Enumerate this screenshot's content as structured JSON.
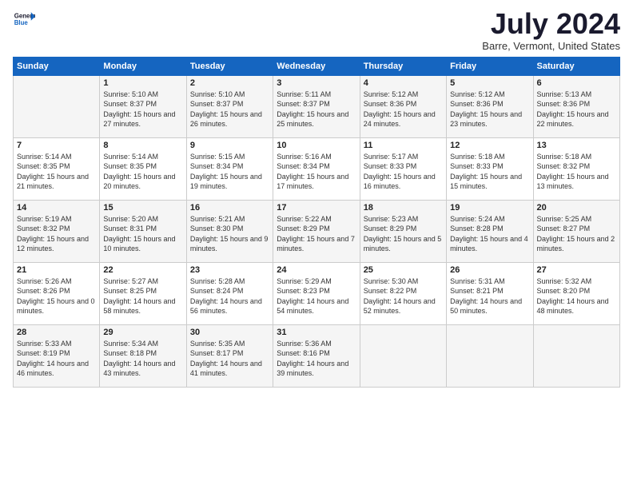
{
  "logo": {
    "line1": "General",
    "line2": "Blue"
  },
  "title": "July 2024",
  "location": "Barre, Vermont, United States",
  "days_header": [
    "Sunday",
    "Monday",
    "Tuesday",
    "Wednesday",
    "Thursday",
    "Friday",
    "Saturday"
  ],
  "weeks": [
    [
      {
        "day": "",
        "info": ""
      },
      {
        "day": "1",
        "info": "Sunrise: 5:10 AM\nSunset: 8:37 PM\nDaylight: 15 hours\nand 27 minutes."
      },
      {
        "day": "2",
        "info": "Sunrise: 5:10 AM\nSunset: 8:37 PM\nDaylight: 15 hours\nand 26 minutes."
      },
      {
        "day": "3",
        "info": "Sunrise: 5:11 AM\nSunset: 8:37 PM\nDaylight: 15 hours\nand 25 minutes."
      },
      {
        "day": "4",
        "info": "Sunrise: 5:12 AM\nSunset: 8:36 PM\nDaylight: 15 hours\nand 24 minutes."
      },
      {
        "day": "5",
        "info": "Sunrise: 5:12 AM\nSunset: 8:36 PM\nDaylight: 15 hours\nand 23 minutes."
      },
      {
        "day": "6",
        "info": "Sunrise: 5:13 AM\nSunset: 8:36 PM\nDaylight: 15 hours\nand 22 minutes."
      }
    ],
    [
      {
        "day": "7",
        "info": "Sunrise: 5:14 AM\nSunset: 8:35 PM\nDaylight: 15 hours\nand 21 minutes."
      },
      {
        "day": "8",
        "info": "Sunrise: 5:14 AM\nSunset: 8:35 PM\nDaylight: 15 hours\nand 20 minutes."
      },
      {
        "day": "9",
        "info": "Sunrise: 5:15 AM\nSunset: 8:34 PM\nDaylight: 15 hours\nand 19 minutes."
      },
      {
        "day": "10",
        "info": "Sunrise: 5:16 AM\nSunset: 8:34 PM\nDaylight: 15 hours\nand 17 minutes."
      },
      {
        "day": "11",
        "info": "Sunrise: 5:17 AM\nSunset: 8:33 PM\nDaylight: 15 hours\nand 16 minutes."
      },
      {
        "day": "12",
        "info": "Sunrise: 5:18 AM\nSunset: 8:33 PM\nDaylight: 15 hours\nand 15 minutes."
      },
      {
        "day": "13",
        "info": "Sunrise: 5:18 AM\nSunset: 8:32 PM\nDaylight: 15 hours\nand 13 minutes."
      }
    ],
    [
      {
        "day": "14",
        "info": "Sunrise: 5:19 AM\nSunset: 8:32 PM\nDaylight: 15 hours\nand 12 minutes."
      },
      {
        "day": "15",
        "info": "Sunrise: 5:20 AM\nSunset: 8:31 PM\nDaylight: 15 hours\nand 10 minutes."
      },
      {
        "day": "16",
        "info": "Sunrise: 5:21 AM\nSunset: 8:30 PM\nDaylight: 15 hours\nand 9 minutes."
      },
      {
        "day": "17",
        "info": "Sunrise: 5:22 AM\nSunset: 8:29 PM\nDaylight: 15 hours\nand 7 minutes."
      },
      {
        "day": "18",
        "info": "Sunrise: 5:23 AM\nSunset: 8:29 PM\nDaylight: 15 hours\nand 5 minutes."
      },
      {
        "day": "19",
        "info": "Sunrise: 5:24 AM\nSunset: 8:28 PM\nDaylight: 15 hours\nand 4 minutes."
      },
      {
        "day": "20",
        "info": "Sunrise: 5:25 AM\nSunset: 8:27 PM\nDaylight: 15 hours\nand 2 minutes."
      }
    ],
    [
      {
        "day": "21",
        "info": "Sunrise: 5:26 AM\nSunset: 8:26 PM\nDaylight: 15 hours\nand 0 minutes."
      },
      {
        "day": "22",
        "info": "Sunrise: 5:27 AM\nSunset: 8:25 PM\nDaylight: 14 hours\nand 58 minutes."
      },
      {
        "day": "23",
        "info": "Sunrise: 5:28 AM\nSunset: 8:24 PM\nDaylight: 14 hours\nand 56 minutes."
      },
      {
        "day": "24",
        "info": "Sunrise: 5:29 AM\nSunset: 8:23 PM\nDaylight: 14 hours\nand 54 minutes."
      },
      {
        "day": "25",
        "info": "Sunrise: 5:30 AM\nSunset: 8:22 PM\nDaylight: 14 hours\nand 52 minutes."
      },
      {
        "day": "26",
        "info": "Sunrise: 5:31 AM\nSunset: 8:21 PM\nDaylight: 14 hours\nand 50 minutes."
      },
      {
        "day": "27",
        "info": "Sunrise: 5:32 AM\nSunset: 8:20 PM\nDaylight: 14 hours\nand 48 minutes."
      }
    ],
    [
      {
        "day": "28",
        "info": "Sunrise: 5:33 AM\nSunset: 8:19 PM\nDaylight: 14 hours\nand 46 minutes."
      },
      {
        "day": "29",
        "info": "Sunrise: 5:34 AM\nSunset: 8:18 PM\nDaylight: 14 hours\nand 43 minutes."
      },
      {
        "day": "30",
        "info": "Sunrise: 5:35 AM\nSunset: 8:17 PM\nDaylight: 14 hours\nand 41 minutes."
      },
      {
        "day": "31",
        "info": "Sunrise: 5:36 AM\nSunset: 8:16 PM\nDaylight: 14 hours\nand 39 minutes."
      },
      {
        "day": "",
        "info": ""
      },
      {
        "day": "",
        "info": ""
      },
      {
        "day": "",
        "info": ""
      }
    ]
  ]
}
